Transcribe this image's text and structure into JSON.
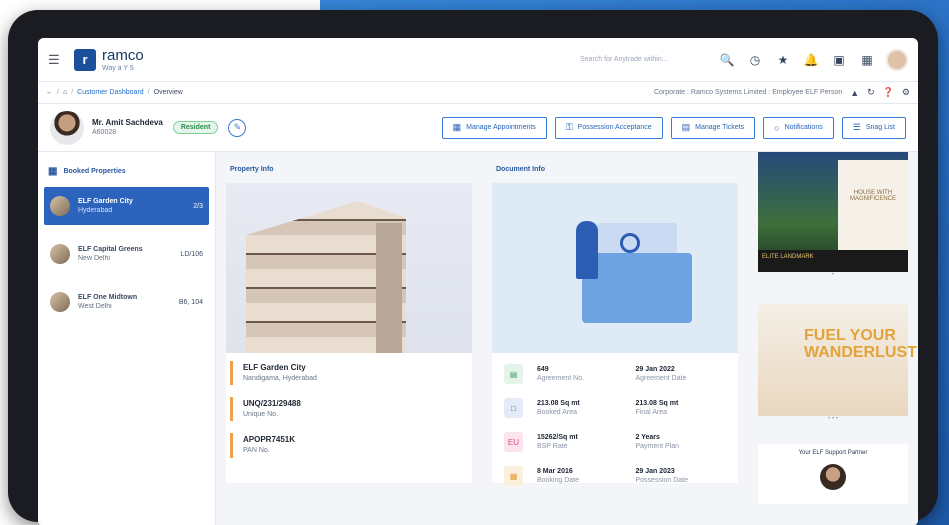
{
  "topbar": {
    "brand_name": "ramco",
    "brand_tagline": "Way a Y 5",
    "search_placeholder": "Search for Anytrade within..."
  },
  "breadcrumb": {
    "items": [
      "Customer Dashboard",
      "Overview"
    ],
    "right_text": "Corporate : Ramco Systems Limited : Employee ELF Person"
  },
  "customer": {
    "name": "Mr. Amit Sachdeva",
    "id": "A60028",
    "status": "Resident"
  },
  "actions": [
    {
      "label": "Manage Appointments"
    },
    {
      "label": "Possession Acceptance"
    },
    {
      "label": "Manage Tickets"
    },
    {
      "label": "Notifications"
    },
    {
      "label": "Snag List"
    }
  ],
  "booked_properties": {
    "title": "Booked Properties",
    "items": [
      {
        "line1": "ELF Garden City",
        "line2": "Hyderabad",
        "unit": "2/3"
      },
      {
        "line1": "ELF Capital Greens",
        "line2": "New Delhi",
        "unit": "LD/106"
      },
      {
        "line1": "ELF One Midtown",
        "line2": "West Delhi",
        "unit": "B6, 104"
      }
    ]
  },
  "property_info": {
    "title": "Property Info",
    "items": [
      {
        "value": "ELF Garden City",
        "label": "Nandigama, Hyderabad"
      },
      {
        "value": "UNQ/231/29488",
        "label": "Unique No."
      },
      {
        "value": "APOPR7451K",
        "label": "PAN No."
      }
    ]
  },
  "document_info": {
    "title": "Document Info",
    "rows": [
      {
        "icon": "pdf-icon",
        "v1": "649",
        "k1": "Agreement No.",
        "v2": "29 Jan 2022",
        "k2": "Agreement Date",
        "color": "#3b9a62"
      },
      {
        "icon": "area-icon",
        "v1": "213.08 Sq mt",
        "k1": "Booked Area",
        "v2": "213.08 Sq mt",
        "k2": "Final Area",
        "color": "#3a5fb8"
      },
      {
        "icon": "eu-icon",
        "v1": "15262/Sq mt",
        "k1": "BSP Rate",
        "v2": "2 Years",
        "k2": "Payment Plan",
        "color": "#d94e8a"
      },
      {
        "icon": "calendar-icon",
        "v1": "8 Mar 2016",
        "k1": "Booking Date",
        "v2": "29 Jan 2023",
        "k2": "Possession Date",
        "color": "#e59a34"
      }
    ]
  },
  "ads": {
    "ad1_right": "HOUSE WITH MAGNIFICENCE",
    "ad1_bottom": "ELITE LANDMARK",
    "ad2_text": "FUEL YOUR WANDERLUST",
    "ad3_title": "Your ELF Support Partner"
  }
}
